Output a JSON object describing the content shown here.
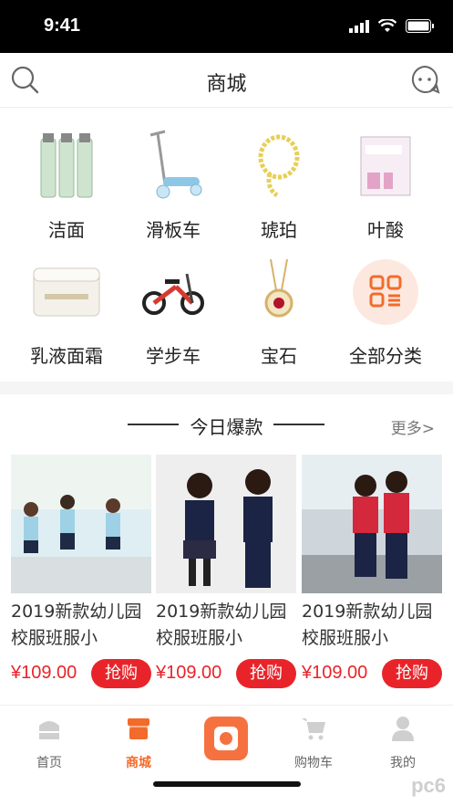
{
  "status_bar": {
    "time": "9:41"
  },
  "nav": {
    "title": "商城"
  },
  "categories": [
    {
      "label": "洁面",
      "icon": "cleanser-bottles"
    },
    {
      "label": "滑板车",
      "icon": "kick-scooter"
    },
    {
      "label": "琥珀",
      "icon": "amber-necklace"
    },
    {
      "label": "叶酸",
      "icon": "folic-acid-box"
    },
    {
      "label": "乳液面霜",
      "icon": "cream-jar"
    },
    {
      "label": "学步车",
      "icon": "balance-bike"
    },
    {
      "label": "宝石",
      "icon": "gem-pendant"
    },
    {
      "label": "全部分类",
      "icon": "all-categories-grid"
    }
  ],
  "hot_section": {
    "title": "今日爆款",
    "more": "更多>"
  },
  "products": [
    {
      "title": "2019新款幼儿园校服班服小",
      "price": "¥109.00",
      "buy": "抢购"
    },
    {
      "title": "2019新款幼儿园校服班服小",
      "price": "¥109.00",
      "buy": "抢购"
    },
    {
      "title": "2019新款幼儿园校服班服小",
      "price": "¥109.00",
      "buy": "抢购"
    }
  ],
  "tabbar": {
    "items": [
      {
        "label": "首页"
      },
      {
        "label": "商城"
      },
      {
        "label": "购物车"
      },
      {
        "label": "我的"
      }
    ]
  },
  "watermark": "pc6",
  "colors": {
    "accent": "#e8242a",
    "tab_active": "#f26b2b",
    "center_button": "#f57240"
  }
}
